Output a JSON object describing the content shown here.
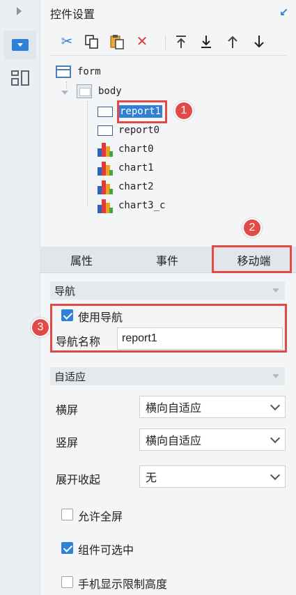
{
  "panel": {
    "title": "控件设置"
  },
  "toolbar": {
    "icons": [
      "cut-icon",
      "copy-icon",
      "paste-icon",
      "delete-icon",
      "move-top-icon",
      "move-bottom-icon",
      "move-up-icon",
      "move-down-icon"
    ],
    "colors": {
      "cut": "#2f80d6",
      "delete": "#e03c3c",
      "default": "#333333"
    }
  },
  "tree": {
    "form": "form",
    "body": "body",
    "items": [
      "report1",
      "report0",
      "chart0",
      "chart1",
      "chart2",
      "chart3_c"
    ]
  },
  "tabs": {
    "attr": "属性",
    "event": "事件",
    "mobile": "移动端"
  },
  "nav": {
    "section": "导航",
    "use_nav": "使用导航",
    "name_label": "导航名称",
    "name_value": "report1"
  },
  "adapt": {
    "section": "自适应",
    "landscape_label": "横屏",
    "landscape_value": "横向自适应",
    "portrait_label": "竖屏",
    "portrait_value": "横向自适应",
    "expand_label": "展开收起",
    "expand_value": "无"
  },
  "options": {
    "allow_fullscreen": "允许全屏",
    "selectable": "组件可选中",
    "limit_height": "手机显示限制高度"
  },
  "badges": [
    "1",
    "2",
    "3"
  ],
  "accent_color": "#2f80d6",
  "highlight_color": "#e24a4a"
}
